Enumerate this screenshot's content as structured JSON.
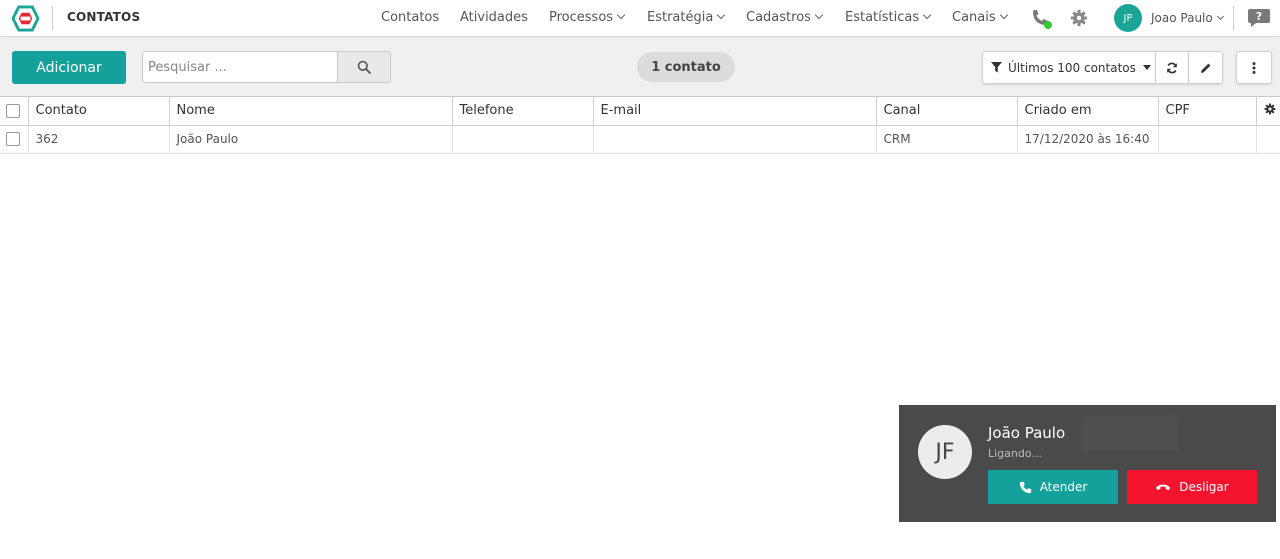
{
  "app": {
    "title": "CONTATOS",
    "logo_icon": "logo-icon",
    "accent_color": "#15a19b"
  },
  "nav": {
    "items": [
      {
        "label": "Contatos",
        "has_dropdown": false
      },
      {
        "label": "Atividades",
        "has_dropdown": false
      },
      {
        "label": "Processos",
        "has_dropdown": true
      },
      {
        "label": "Estratégia",
        "has_dropdown": true
      },
      {
        "label": "Cadastros",
        "has_dropdown": true
      },
      {
        "label": "Estatísticas",
        "has_dropdown": true
      },
      {
        "label": "Canais",
        "has_dropdown": true
      }
    ],
    "phone_status_color": "#2ecc2e"
  },
  "user": {
    "initials": "JP",
    "name": "Joao Paulo"
  },
  "toolbar": {
    "add_label": "Adicionar",
    "search_placeholder": "Pesquisar ...",
    "count_label": "1 contato",
    "filter_label": "Últimos 100 contatos"
  },
  "table": {
    "columns": [
      "Contato",
      "Nome",
      "Telefone",
      "E-mail",
      "Canal",
      "Criado em",
      "CPF"
    ],
    "rows": [
      {
        "contato": "362",
        "nome": "João Paulo",
        "telefone": "",
        "email": "",
        "canal": "CRM",
        "criado_em": "17/12/2020 às 16:40",
        "cpf": ""
      }
    ]
  },
  "call": {
    "initials": "JF",
    "name": "João Paulo",
    "status": "Ligando...",
    "answer_label": "Atender",
    "hangup_label": "Desligar",
    "answer_color": "#15a19b",
    "hangup_color": "#f5132d"
  }
}
